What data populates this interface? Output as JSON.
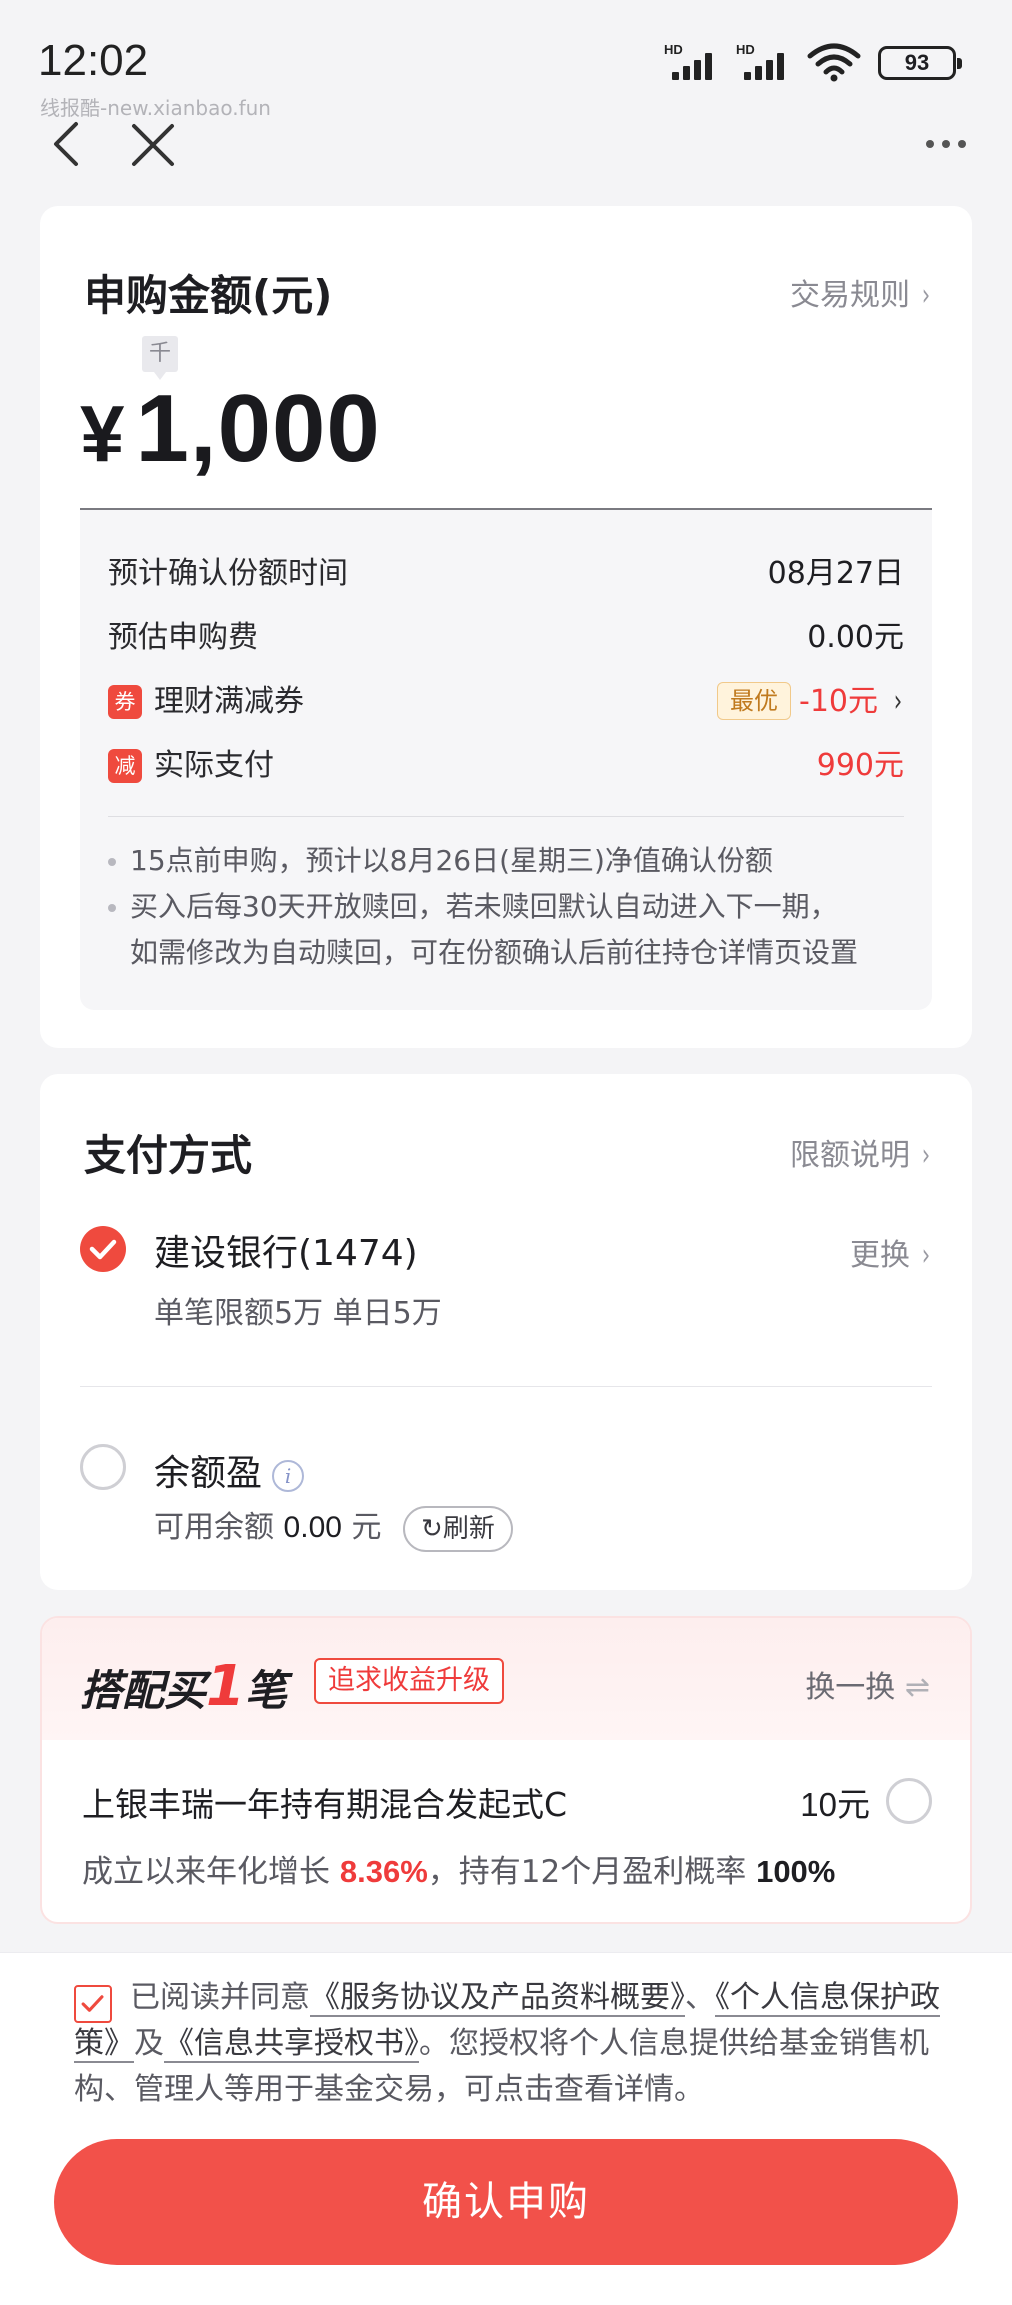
{
  "status": {
    "time": "12:02",
    "hd1": "HD",
    "hd2": "HD",
    "battery": "93",
    "watermark": "线报酷-new.xianbao.fun"
  },
  "amount_card": {
    "title": "申购金额(元)",
    "rules_link": "交易规则",
    "unit_tag": "千",
    "currency": "¥",
    "amount": "1,000",
    "rows": {
      "confirm_time_label": "预计确认份额时间",
      "confirm_time_value": "08月27日",
      "fee_label": "预估申购费",
      "fee_value": "0.00元",
      "coupon_badge": "券",
      "coupon_label": "理财满减券",
      "coupon_best": "最优",
      "coupon_value": "-10元",
      "pay_badge": "减",
      "pay_label": "实际支付",
      "pay_value": "990元"
    },
    "notes": {
      "note1": "15点前申购，预计以8月26日(星期三)净值确认份额",
      "note2_line1": "买入后每30天开放赎回，若未赎回默认自动进入下一期，",
      "note2_line2": "如需修改为自动赎回，可在份额确认后前往持仓详情页设置"
    }
  },
  "payment": {
    "title": "支付方式",
    "limit_link": "限额说明",
    "bank_name": "建设银行(1474)",
    "bank_limit": "单笔限额5万 单日5万",
    "change_link": "更换",
    "balance_name": "余额盈",
    "balance_label": "可用余额",
    "balance_value": "0.00",
    "balance_unit": "元",
    "refresh_label": "刷新"
  },
  "combo": {
    "title_a": "搭配买",
    "title_num": "1",
    "title_b": "笔",
    "tag": "追求收益升级",
    "swap_label": "换一换",
    "fund_name": "上银丰瑞一年持有期混合发起式C",
    "fund_amount": "10元",
    "desc_a": "成立以来年化增长",
    "desc_rate": "8.36%",
    "desc_b": "，持有12个月盈利概率",
    "desc_prob": "100%"
  },
  "agreement": {
    "prefix": "已阅读并同意",
    "doc1": "《服务协议及产品资料概要》",
    "sep1": "、",
    "doc2": "《个人信息保护政策》",
    "sep2": "及",
    "doc3": "《信息共享授权书》",
    "suffix": "。您授权将个人信息提供给基金销售机构、管理人等用于基金交易，可点击查看详情。"
  },
  "confirm_button": "确认申购",
  "colors": {
    "accent": "#ef4a3e",
    "button": "#f2514a",
    "gray_text": "#8a8a92"
  }
}
